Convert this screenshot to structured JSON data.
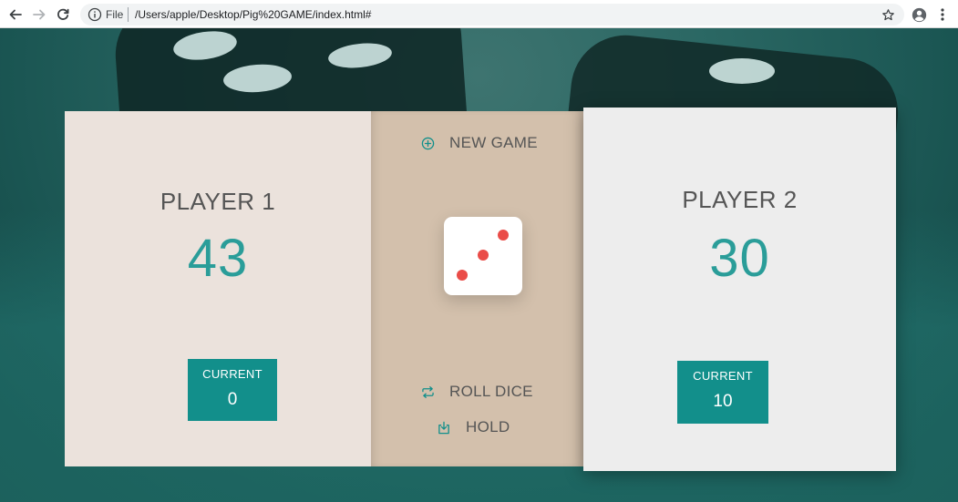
{
  "browser": {
    "file_label": "File",
    "url": "/Users/apple/Desktop/Pig%20GAME/index.html#"
  },
  "icons": {
    "back": "back-arrow-icon",
    "forward": "forward-arrow-icon",
    "reload": "reload-icon",
    "info": "info-icon",
    "star": "star-icon",
    "profile": "profile-icon",
    "menu": "kebab-menu-icon",
    "new_game": "plus-circle-icon",
    "roll_dice": "repeat-arrows-icon",
    "hold": "download-tray-icon"
  },
  "colors": {
    "accent": "#128f8b",
    "score": "#2a9d99",
    "dice_dot": "#ea4c48",
    "player1_panel": "#ebe2dc",
    "player2_panel": "#ededed",
    "center_panel": "#d3c0ac"
  },
  "game": {
    "player1": {
      "name": "PLAYER 1",
      "score": "43",
      "current_label": "CURRENT",
      "current": "0"
    },
    "player2": {
      "name": "PLAYER 2",
      "score": "30",
      "current_label": "CURRENT",
      "current": "10"
    },
    "controls": {
      "new_game": "NEW GAME",
      "roll_dice": "ROLL DICE",
      "hold": "HOLD"
    },
    "dice_value": 3
  }
}
